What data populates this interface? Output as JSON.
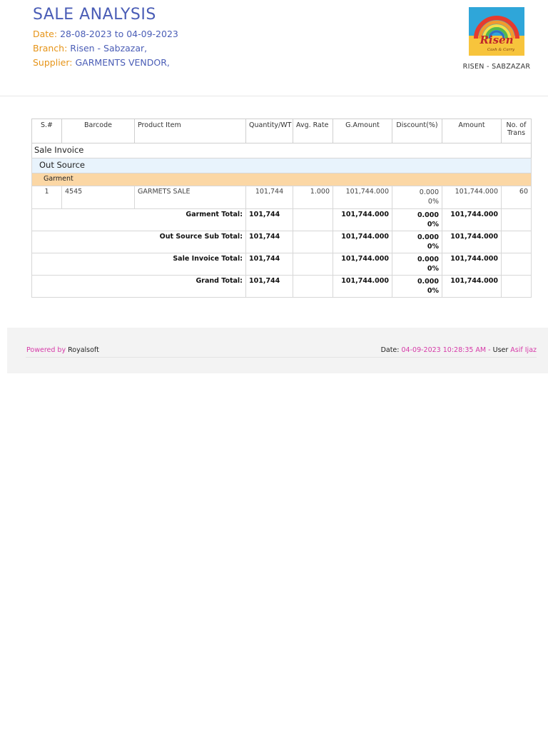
{
  "header": {
    "title": "SALE ANALYSIS",
    "date_label": "Date:",
    "date_value": "28-08-2023 to 04-09-2023",
    "branch_label": "Branch:",
    "branch_value": "Risen - Sabzazar,",
    "supplier_label": "Supplier:",
    "supplier_value": "GARMENTS VENDOR,",
    "logo_text": "Risen",
    "logo_subtext": "Cash & Carry",
    "logo_caption": "RISEN - SABZAZAR"
  },
  "table": {
    "columns": [
      "S.#",
      "Barcode",
      "Product Item",
      "Quantity/WT",
      "Avg. Rate",
      "G.Amount",
      "Discount(%)",
      "Amount",
      "No. of Trans"
    ],
    "group_sale": "Sale Invoice",
    "group_out": "Out Source",
    "group_garment": "Garment",
    "item": {
      "sn": "1",
      "barcode": "4545",
      "product": "GARMETS SALE",
      "qty": "101,744",
      "rate": "1.000",
      "gamount": "101,744.000",
      "discount": "0.000",
      "discount_pct": "0%",
      "amount": "101,744.000",
      "trans": "60"
    },
    "totals": [
      {
        "label": "Garment Total:",
        "qty": "101,744",
        "gamount": "101,744.000",
        "discount": "0.000",
        "discount_pct": "0%",
        "amount": "101,744.000"
      },
      {
        "label": "Out Source Sub Total:",
        "qty": "101,744",
        "gamount": "101,744.000",
        "discount": "0.000",
        "discount_pct": "0%",
        "amount": "101,744.000"
      },
      {
        "label": "Sale Invoice Total:",
        "qty": "101,744",
        "gamount": "101,744.000",
        "discount": "0.000",
        "discount_pct": "0%",
        "amount": "101,744.000"
      },
      {
        "label": "Grand Total:",
        "qty": "101,744",
        "gamount": "101,744.000",
        "discount": "0.000",
        "discount_pct": "0%",
        "amount": "101,744.000"
      }
    ]
  },
  "footer": {
    "powered_label": "Powered by",
    "powered_value": "Royalsoft",
    "date_label": "Date:",
    "date_value": "04-09-2023 10:28:35 AM",
    "user_sep": " - ",
    "user_label": "User",
    "user_value": "Asif Ijaz"
  },
  "colors": {
    "title": "#4a5db6",
    "label_orange": "#e69418",
    "value_blue": "#4a5db6",
    "out_source_bg": "#e8f3fc",
    "garment_bg": "#fbd7a5",
    "footer_pink": "#d63aa8"
  }
}
